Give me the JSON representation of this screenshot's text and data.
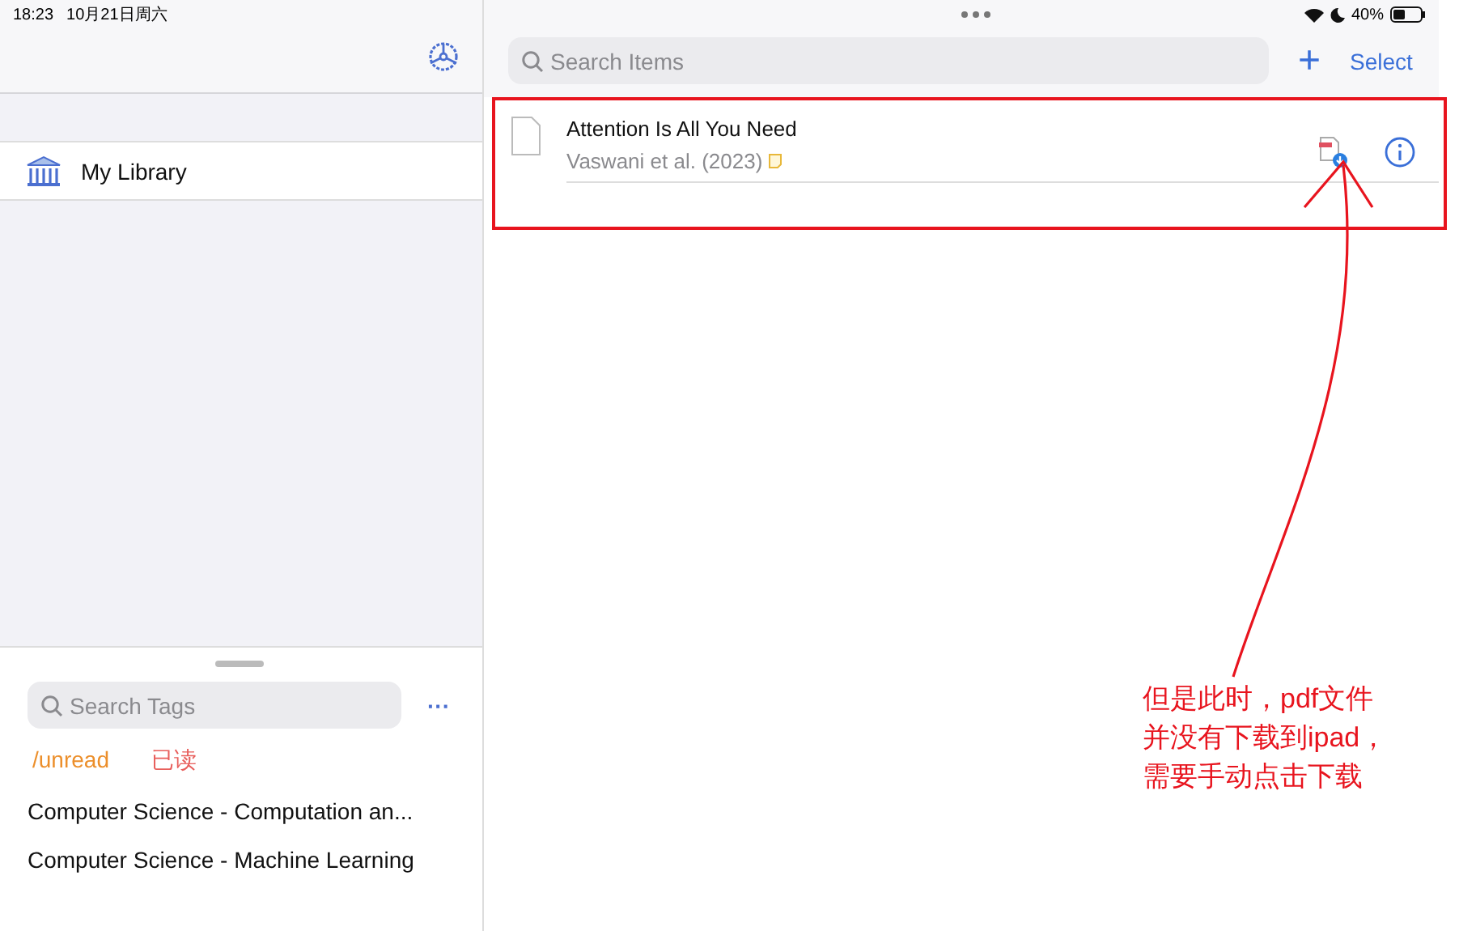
{
  "status_bar": {
    "time": "18:23",
    "date": "10月21日周六",
    "battery": "40%"
  },
  "sidebar": {
    "libraries": [
      {
        "label": "My Library"
      }
    ],
    "tags": {
      "search": {
        "placeholder": "Search Tags"
      },
      "more": "···",
      "colored_tags": [
        {
          "label": "/unread",
          "color": "#ec8f2b"
        },
        {
          "label": "已读",
          "color": "#e85f5c"
        }
      ],
      "items": [
        "Computer Science - Computation an...",
        "Computer Science - Machine Learning"
      ]
    }
  },
  "items": {
    "search": {
      "placeholder": "Search Items"
    },
    "add": "+",
    "select": "Select",
    "rows": [
      {
        "title": "Attention Is All You Need",
        "subtitle": "Vaswani et al. (2023)"
      }
    ]
  },
  "annotation": {
    "lines": [
      "但是此时，pdf文件",
      "并没有下载到ipad，",
      "需要手动点击下载"
    ]
  }
}
